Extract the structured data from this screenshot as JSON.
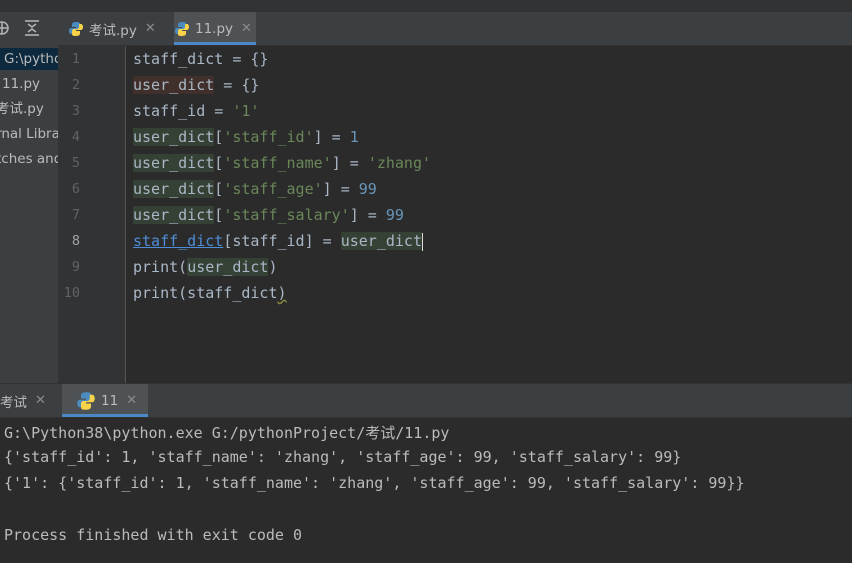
{
  "project": {
    "tree": [
      {
        "label": "G:\\pytho",
        "selected": true
      },
      {
        "label": "11.py"
      },
      {
        "label": "考试.py"
      },
      {
        "label": "rnal Libra"
      },
      {
        "label": "tches and"
      }
    ]
  },
  "editor": {
    "tabs": [
      {
        "label": "考试.py",
        "active": false
      },
      {
        "label": "11.py",
        "active": true
      }
    ],
    "line_numbers": [
      "1",
      "2",
      "3",
      "4",
      "5",
      "6",
      "7",
      "8",
      "9",
      "10"
    ],
    "lines": [
      {
        "a": "staff_dict",
        "b": " = {}"
      },
      {
        "a": "user_dict",
        "b": " = {}"
      },
      {
        "a": "staff_id = ",
        "b": "'1'"
      },
      {
        "a": "user_dict",
        "b": "[",
        "c": "'staff_id'",
        "d": "] = ",
        "e": "1"
      },
      {
        "a": "user_dict",
        "b": "[",
        "c": "'staff_name'",
        "d": "] = ",
        "e": "'zhang'"
      },
      {
        "a": "user_dict",
        "b": "[",
        "c": "'staff_age'",
        "d": "] = ",
        "e": "99"
      },
      {
        "a": "user_dict",
        "b": "[",
        "c": "'staff_salary'",
        "d": "] = ",
        "e": "99"
      },
      {
        "a": "staff_dict",
        "b": "[staff_id] = ",
        "c": "user_dict"
      },
      {
        "a": "print(",
        "b": "user_dict",
        "c": ")"
      },
      {
        "a": "print(staff_dict",
        "b": ")"
      }
    ]
  },
  "run": {
    "tabs": [
      {
        "label": "考试",
        "active": false
      },
      {
        "label": "11",
        "active": true
      }
    ],
    "output": [
      "G:\\Python38\\python.exe G:/pythonProject/考试/11.py",
      "{'staff_id': 1, 'staff_name': 'zhang', 'staff_age': 99, 'staff_salary': 99}",
      "{'1': {'staff_id': 1, 'staff_name': 'zhang', 'staff_age': 99, 'staff_salary': 99}}",
      "",
      "Process finished with exit code 0"
    ]
  },
  "colors": {
    "string": "#6a8759",
    "number": "#6897bb",
    "background": "#2b2b2b",
    "accent": "#4a88c7"
  }
}
